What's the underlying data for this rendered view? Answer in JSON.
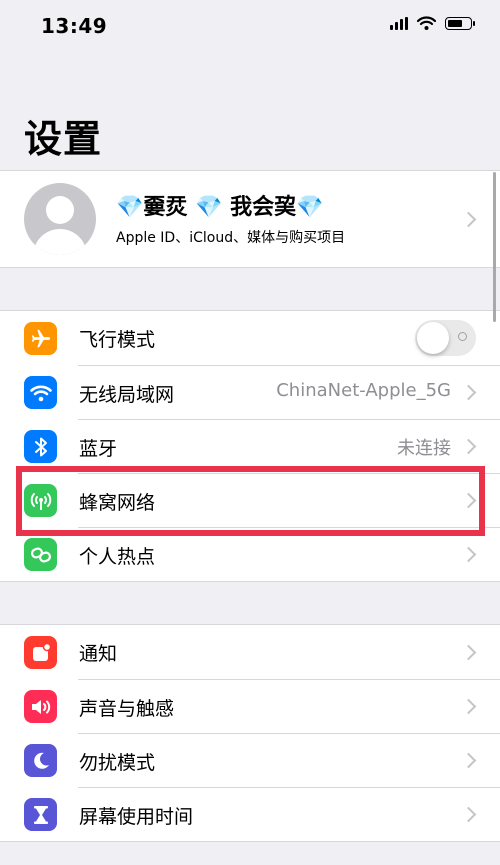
{
  "status_bar": {
    "time": "13:49",
    "battery_level": 0.7
  },
  "page_title": "设置",
  "profile": {
    "name": "💎嫑烎 💎 我会巭💎",
    "subtitle": "Apple ID、iCloud、媒体与购买项目"
  },
  "connectivity_section": {
    "rows": [
      {
        "label": "飞行模式",
        "icon": "airplane-icon",
        "icon_color": "#ff9500",
        "toggle_on": false
      },
      {
        "label": "无线局域网",
        "icon": "wifi-icon",
        "icon_color": "#007aff",
        "value": "ChinaNet-Apple_5G"
      },
      {
        "label": "蓝牙",
        "icon": "bluetooth-icon",
        "icon_color": "#007aff",
        "value": "未连接"
      },
      {
        "label": "蜂窝网络",
        "icon": "antenna-icon",
        "icon_color": "#34c759",
        "highlighted": true
      },
      {
        "label": "个人热点",
        "icon": "hotspot-icon",
        "icon_color": "#34c759"
      }
    ]
  },
  "notifications_section": {
    "rows": [
      {
        "label": "通知",
        "icon": "notification-icon",
        "icon_color": "#ff3b30"
      },
      {
        "label": "声音与触感",
        "icon": "speaker-icon",
        "icon_color": "#ff2d55"
      },
      {
        "label": "勿扰模式",
        "icon": "moon-icon",
        "icon_color": "#5856d6"
      },
      {
        "label": "屏幕使用时间",
        "icon": "hourglass-icon",
        "icon_color": "#5856d6"
      }
    ]
  },
  "annotation": {
    "highlight_color": "#e8334a"
  }
}
